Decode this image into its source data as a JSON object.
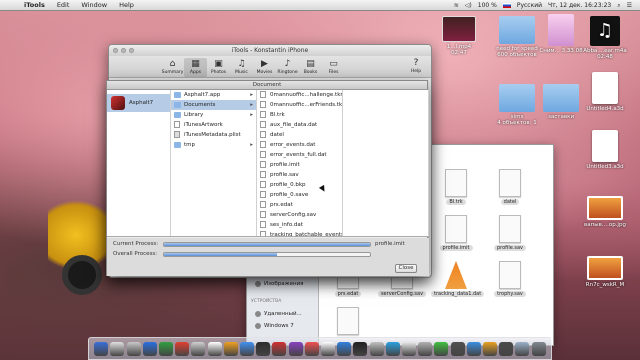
{
  "menubar": {
    "apple": "",
    "items": [
      "iTools",
      "Edit",
      "Window",
      "Help"
    ],
    "right": {
      "battery": "100 %",
      "language": "Русский",
      "clock": "Чт, 12 дек.  16:23:23"
    }
  },
  "desktop_icons": [
    {
      "label": "1...l.mp4\n02:47",
      "kind": "video"
    },
    {
      "label": "need for speed\n600 объектов",
      "kind": "folder"
    },
    {
      "label": "Сним... 3.33.08",
      "kind": "pink"
    },
    {
      "label": "Abba....ear.m4a\n02:48",
      "kind": "music"
    },
    {
      "label": "sims\n4 объектов: 1",
      "kind": "folder"
    },
    {
      "label": "заставки",
      "kind": "folder"
    },
    {
      "label": "Untitled4.a3d",
      "kind": "doc"
    },
    {
      "label": "Untitled3.a3d",
      "kind": "doc"
    },
    {
      "label": "вапыв....op.jpg",
      "kind": "orange"
    },
    {
      "label": "Rn7c_wskR_M",
      "kind": "orange"
    }
  ],
  "itools": {
    "title": "iTools - Konstantin iPhone",
    "toolbar": [
      {
        "label": "Summary",
        "icon": "home-icon",
        "glyph": "⌂"
      },
      {
        "label": "Apps",
        "icon": "apps-icon",
        "glyph": "▦",
        "active": true
      },
      {
        "label": "Photos",
        "icon": "photos-icon",
        "glyph": "▣"
      },
      {
        "label": "Music",
        "icon": "music-icon",
        "glyph": "♫"
      },
      {
        "label": "Movies",
        "icon": "movies-icon",
        "glyph": "▶"
      },
      {
        "label": "Ringtone",
        "icon": "bell-icon",
        "glyph": "♪"
      },
      {
        "label": "Books",
        "icon": "books-icon",
        "glyph": "▤"
      },
      {
        "label": "Files",
        "icon": "files-icon",
        "glyph": "▭"
      }
    ],
    "help": {
      "label": "Help",
      "glyph": "?"
    }
  },
  "document": {
    "title": "Document",
    "col1": [
      {
        "label": "Asphalt7",
        "selected": true
      }
    ],
    "col2": [
      {
        "label": "Asphalt7.app",
        "type": "folder",
        "has_children": true
      },
      {
        "label": "Documents",
        "type": "folder",
        "has_children": true,
        "selected": true
      },
      {
        "label": "Library",
        "type": "folder",
        "has_children": true
      },
      {
        "label": "iTunesArtwork",
        "type": "file"
      },
      {
        "label": "iTunesMetadata.plist",
        "type": "plist"
      },
      {
        "label": "tmp",
        "type": "folder",
        "has_children": true
      }
    ],
    "col3": [
      "0mannuoffic...hallenge.tkr",
      "0mannuoffic...erFriends.tkr",
      "Bl.trk",
      "aux_file_data.dat",
      "datel",
      "error_events.dat",
      "error_events_full.dat",
      "profile.imit",
      "profile.sav",
      "profile_0.bkp",
      "profile_0.save",
      "prs.edat",
      "serverConfig.sav",
      "ses_info.dat",
      "tracking_batchable_events..."
    ],
    "current_process": {
      "label": "Current Process:",
      "file": "profile.imit",
      "progress": 1.0
    },
    "overall_process": {
      "label": "Overall Process:",
      "progress": 0.55
    },
    "close_label": "Close"
  },
  "finder": {
    "sidebar": [
      {
        "label": "Музыка",
        "type": "item"
      },
      {
        "label": "Изображения",
        "type": "item"
      },
      {
        "label": "УСТРОЙСТВА",
        "type": "head"
      },
      {
        "label": "Удаленный...",
        "type": "item"
      },
      {
        "label": "Windows 7",
        "type": "item"
      }
    ],
    "files": [
      {
        "label": "",
        "kind": "doc"
      },
      {
        "label": "",
        "kind": "doc"
      },
      {
        "label": "Bl.trk",
        "kind": "doc"
      },
      {
        "label": "datel",
        "kind": "doc"
      },
      {
        "label": "",
        "kind": "doc"
      },
      {
        "label": "",
        "kind": "doc"
      },
      {
        "label": "profile.imit",
        "kind": "doc"
      },
      {
        "label": "profile.sav",
        "kind": "doc"
      },
      {
        "label": "prs.edat",
        "kind": "doc"
      },
      {
        "label": "serverConfig.sav",
        "kind": "doc"
      },
      {
        "label": "tracking_data1.dat",
        "kind": "cone"
      },
      {
        "label": "trophy.sav",
        "kind": "doc"
      },
      {
        "label": "",
        "kind": "doc"
      }
    ]
  },
  "dock": {
    "colors": [
      "#3a6fd8",
      "#e0e0e0",
      "#c8c8c8",
      "#2a70e0",
      "#30a040",
      "#e04030",
      "#d0d0d0",
      "#ffffff",
      "#f0a020",
      "#4090f0",
      "#2c2c2c",
      "#d03030",
      "#8a40c0",
      "#f05050",
      "#ffffff",
      "#3080e0",
      "#202020",
      "#c0c0c0",
      "#2aa0e0",
      "#e8e8e8",
      "#b0b0b0",
      "#40c040",
      "#505050",
      "#3a8ee0",
      "#e8a020",
      "#4a4a4a",
      "#9ab0c8",
      "#808890"
    ]
  }
}
